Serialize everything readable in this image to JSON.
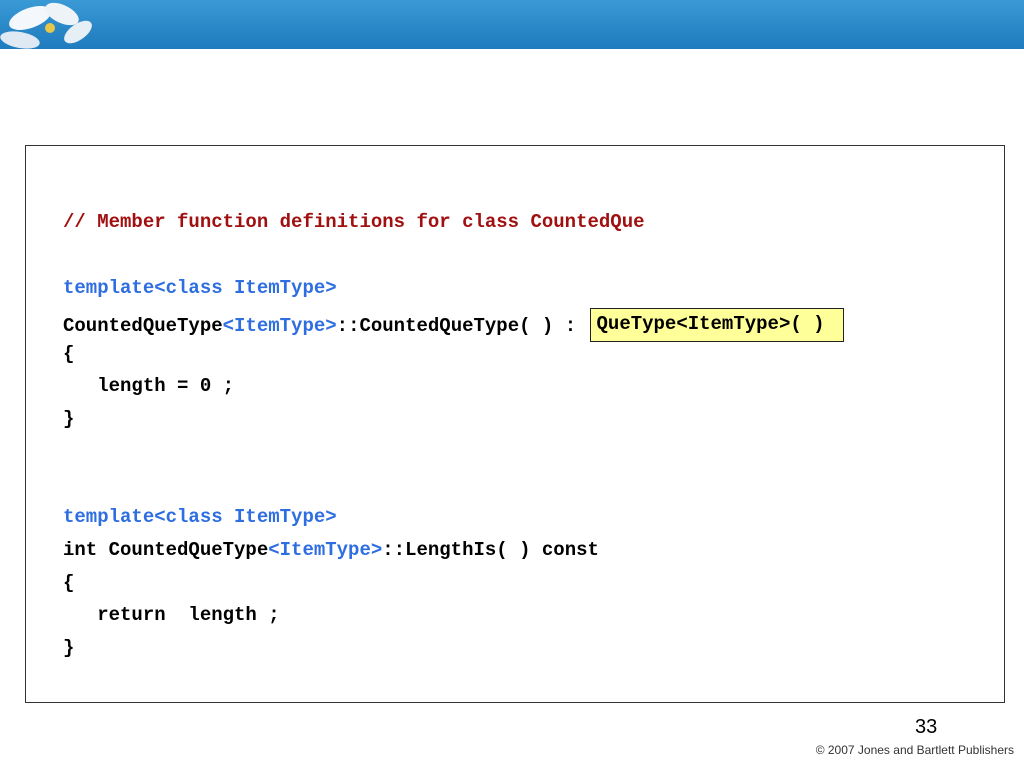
{
  "slide": {
    "comment": "// Member function definitions for class CountedQue",
    "block1": {
      "template": "template<class ItemType>",
      "sig_pre": "CountedQueType",
      "sig_type": "<ItemType>",
      "sig_post": "::CountedQueType( ) : ",
      "sig_highlight": "QueType<ItemType>( )",
      "open": "{",
      "body": "   length = 0 ;",
      "close": "}"
    },
    "block2": {
      "template": "template<class ItemType>",
      "sig_pre": "int CountedQueType",
      "sig_type": "<ItemType>",
      "sig_post": "::LengthIs( ) const",
      "open": "{",
      "body": "   return  length ;",
      "close": "}"
    },
    "page_number": "33",
    "copyright": "© 2007 Jones and Bartlett Publishers"
  },
  "colors": {
    "header": "#2a88c8",
    "comment": "#a01010",
    "keyword_blue": "#2e6ee0",
    "highlight": "#ffff99"
  }
}
